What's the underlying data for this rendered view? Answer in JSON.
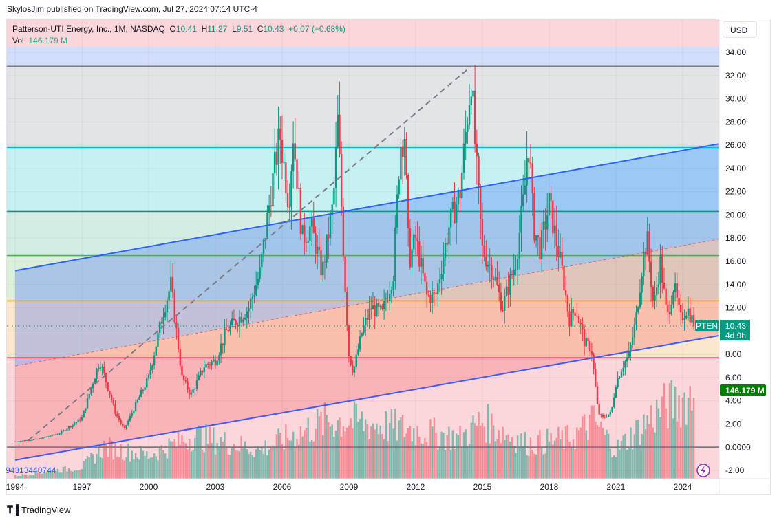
{
  "header": {
    "published": "SkylosJim published on TradingView.com, Jul 27, 2024 07:14 UTC-4"
  },
  "legend": {
    "symbol": "Patterson-UTI Energy, Inc., 1M, NASDAQ",
    "o_label": "O",
    "o": "10.41",
    "h_label": "H",
    "h": "11.27",
    "l_label": "L",
    "l": "9.51",
    "c_label": "C",
    "c": "10.43",
    "change": "+0.07 (+0.68%)",
    "vol_label": "Vol",
    "vol": "146.179 M"
  },
  "currency": "USD",
  "badges": {
    "ticker": "PTEN",
    "price": "10.43",
    "countdown": "4d 9h",
    "volume": "146.179 M",
    "left_value": "94313440744"
  },
  "footer": {
    "brand": "TradingView"
  },
  "colors": {
    "up": "#089981",
    "down": "#f23645",
    "channel": "#2962ff",
    "accent": "#089981"
  },
  "chart_data": {
    "type": "candlestick",
    "interval": "1M",
    "yrange": [
      -2,
      34
    ],
    "ytick_labels": [
      "34.00",
      "32.00",
      "30.00",
      "28.00",
      "26.00",
      "24.00",
      "22.00",
      "20.00",
      "18.00",
      "16.00",
      "14.00",
      "12.00",
      "10.00",
      "8.00",
      "6.00",
      "4.00",
      "2.00",
      "0.0000",
      "-2.00"
    ],
    "yticks": [
      34,
      32,
      30,
      28,
      26,
      24,
      22,
      20,
      18,
      16,
      14,
      12,
      10,
      8,
      6,
      4,
      2,
      0,
      -2
    ],
    "xrange": [
      1993.6,
      2025.6
    ],
    "xticks": [
      1994,
      1997,
      2000,
      2003,
      2006,
      2009,
      2012,
      2015,
      2018,
      2021,
      2024
    ],
    "xtick_labels": [
      "1994",
      "1997",
      "2000",
      "2003",
      "2006",
      "2009",
      "2012",
      "2015",
      "2018",
      "2021",
      "2024"
    ],
    "horizontal_levels": [
      {
        "price": 32.8,
        "color": "#787b86"
      },
      {
        "price": 25.8,
        "color": "#00bcd4"
      },
      {
        "price": 20.3,
        "color": "#089981"
      },
      {
        "price": 16.5,
        "color": "#4caf50"
      },
      {
        "price": 12.6,
        "color": "#ff9800"
      },
      {
        "price": 7.7,
        "color": "#f23645"
      },
      {
        "price": 0,
        "color": "#787b86"
      }
    ],
    "bands": [
      {
        "from": 32.8,
        "to": 25.8,
        "color": "#e3e4e8"
      },
      {
        "from": 25.8,
        "to": 20.3,
        "color": "#c8f0f2"
      },
      {
        "from": 20.3,
        "to": 16.5,
        "color": "#d3ece4"
      },
      {
        "from": 16.5,
        "to": 12.6,
        "color": "#dcefdc"
      },
      {
        "from": 12.6,
        "to": 7.7,
        "color": "#fde7cc"
      },
      {
        "from": 7.7,
        "to": -2.6,
        "color": "#fbd6da"
      },
      {
        "from": 34.5,
        "to": 32.8,
        "color": "#d3defb"
      }
    ],
    "channel": {
      "upper": [
        [
          1994,
          15.2
        ],
        [
          2025.6,
          26.1
        ]
      ],
      "middle": [
        [
          1994,
          7
        ],
        [
          2025.6,
          17.9
        ]
      ],
      "lower": [
        [
          1994,
          -1.1
        ],
        [
          2025.6,
          9.6
        ]
      ]
    },
    "trend_line": [
      [
        1994.6,
        0.6
      ],
      [
        2014.5,
        32.8
      ]
    ],
    "last_price": 10.43,
    "price_path": [
      [
        1994.0,
        0.5
      ],
      [
        1995,
        0.7
      ],
      [
        1996,
        1.2
      ],
      [
        1997,
        2.5
      ],
      [
        1997.8,
        7.5
      ],
      [
        1998.5,
        3
      ],
      [
        1998.9,
        1.5
      ],
      [
        1999.5,
        4
      ],
      [
        2000,
        6
      ],
      [
        2000.7,
        12
      ],
      [
        2001.0,
        14
      ],
      [
        2001.5,
        6
      ],
      [
        2001.9,
        4.5
      ],
      [
        2002.5,
        7
      ],
      [
        2003,
        7.5
      ],
      [
        2003.5,
        10
      ],
      [
        2004,
        11
      ],
      [
        2004.5,
        12
      ],
      [
        2005,
        15
      ],
      [
        2005.5,
        22
      ],
      [
        2005.9,
        27
      ],
      [
        2006.3,
        21
      ],
      [
        2006.5,
        27
      ],
      [
        2006.9,
        18
      ],
      [
        2007.3,
        19
      ],
      [
        2007.8,
        15
      ],
      [
        2008.3,
        21
      ],
      [
        2008.5,
        28
      ],
      [
        2008.8,
        15
      ],
      [
        2009.0,
        8
      ],
      [
        2009.2,
        6.5
      ],
      [
        2009.6,
        10
      ],
      [
        2010,
        12
      ],
      [
        2010.5,
        11.5
      ],
      [
        2011,
        15
      ],
      [
        2011.3,
        26
      ],
      [
        2011.5,
        27
      ],
      [
        2011.7,
        16
      ],
      [
        2012,
        18
      ],
      [
        2012.5,
        13
      ],
      [
        2012.9,
        13
      ],
      [
        2013.5,
        19
      ],
      [
        2014.0,
        22
      ],
      [
        2014.3,
        28
      ],
      [
        2014.5,
        32
      ],
      [
        2014.7,
        25
      ],
      [
        2015.0,
        17
      ],
      [
        2015.5,
        15
      ],
      [
        2015.9,
        12
      ],
      [
        2016.2,
        14
      ],
      [
        2016.5,
        16
      ],
      [
        2016.9,
        22
      ],
      [
        2017.0,
        25
      ],
      [
        2017.1,
        26
      ],
      [
        2017.3,
        19
      ],
      [
        2017.6,
        17
      ],
      [
        2018.0,
        21
      ],
      [
        2018.3,
        18
      ],
      [
        2018.6,
        15
      ],
      [
        2018.9,
        11
      ],
      [
        2019.2,
        12
      ],
      [
        2019.6,
        9
      ],
      [
        2019.9,
        8.5
      ],
      [
        2020.2,
        3
      ],
      [
        2020.4,
        2.5
      ],
      [
        2020.8,
        3
      ],
      [
        2021.0,
        5.5
      ],
      [
        2021.3,
        7
      ],
      [
        2021.6,
        8
      ],
      [
        2021.9,
        11
      ],
      [
        2022.2,
        16
      ],
      [
        2022.4,
        18
      ],
      [
        2022.7,
        12
      ],
      [
        2023.0,
        16
      ],
      [
        2023.3,
        11
      ],
      [
        2023.6,
        14
      ],
      [
        2023.9,
        11
      ],
      [
        2024.2,
        12
      ],
      [
        2024.55,
        10.43
      ]
    ],
    "volume_millions_path": [
      [
        1994,
        5
      ],
      [
        1997,
        20
      ],
      [
        1998,
        55
      ],
      [
        2000,
        40
      ],
      [
        2002,
        75
      ],
      [
        2005,
        50
      ],
      [
        2008,
        100
      ],
      [
        2009,
        100
      ],
      [
        2011,
        90
      ],
      [
        2014,
        70
      ],
      [
        2015,
        100
      ],
      [
        2017,
        60
      ],
      [
        2019,
        70
      ],
      [
        2020,
        100
      ],
      [
        2021,
        50
      ],
      [
        2023,
        120
      ],
      [
        2024.55,
        146.179
      ]
    ]
  }
}
